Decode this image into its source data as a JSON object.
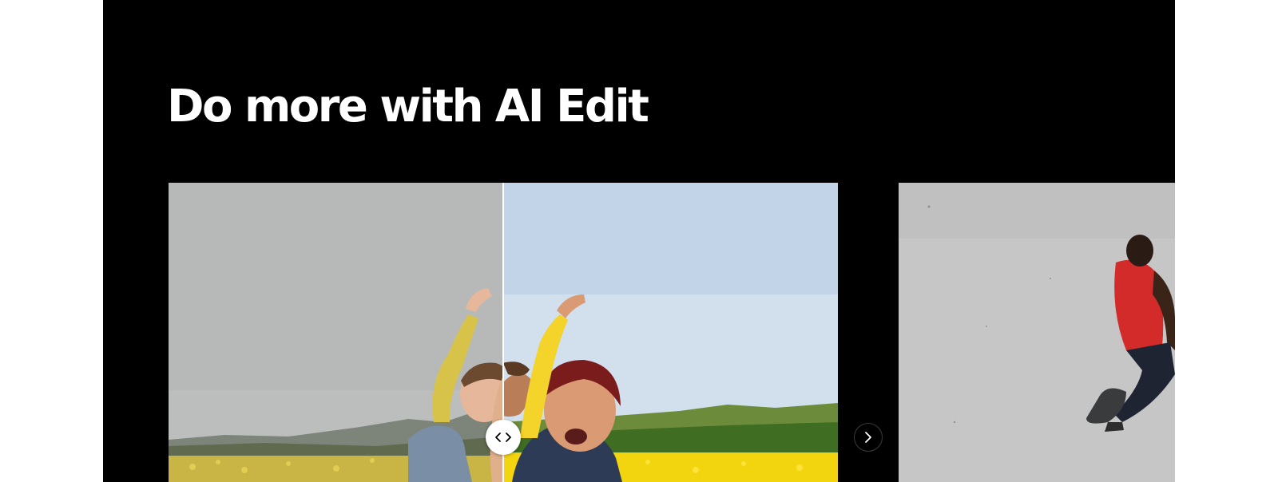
{
  "section": {
    "title": "Do more with AI Edit"
  },
  "slider": {
    "handle_icon": "left-right-arrows-icon",
    "position_percent": 50
  },
  "carousel": {
    "next_icon": "chevron-right-icon"
  },
  "colors": {
    "background": "#000000",
    "page": "#ffffff",
    "title": "#ffffff",
    "field_yellow": "#f2d40f",
    "sky_after": "#c9d9ea",
    "sky_before": "#b9bcbc"
  }
}
